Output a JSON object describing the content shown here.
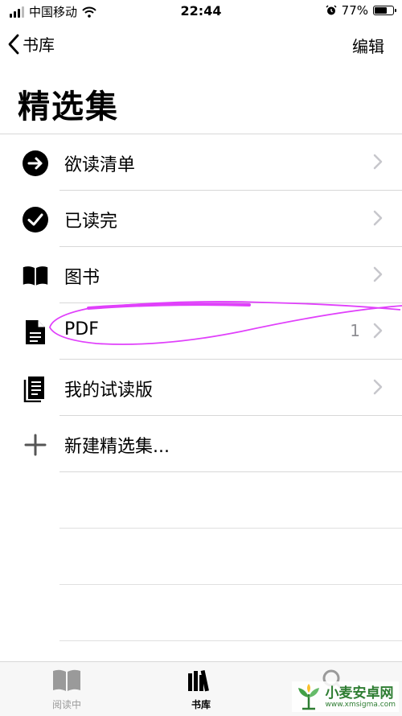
{
  "status_bar": {
    "carrier": "中国移动",
    "time": "22:44",
    "battery_percent": "77%",
    "battery_level": 0.77,
    "icons": [
      "signal-icon",
      "wifi-icon",
      "alarm-icon",
      "battery-icon"
    ]
  },
  "nav": {
    "back_label": "书库",
    "edit_label": "编辑"
  },
  "page": {
    "title": "精选集"
  },
  "collections": [
    {
      "label": "欲读清单",
      "icon": "arrow-right-circle-icon",
      "count": ""
    },
    {
      "label": "已读完",
      "icon": "checkmark-circle-icon",
      "count": ""
    },
    {
      "label": "图书",
      "icon": "book-open-icon",
      "count": ""
    },
    {
      "label": "PDF",
      "icon": "document-icon",
      "count": "1"
    },
    {
      "label": "我的试读版",
      "icon": "sample-pages-icon",
      "count": ""
    },
    {
      "label": "新建精选集...",
      "icon": "plus-icon",
      "count": ""
    }
  ],
  "tab_bar": {
    "tabs": [
      {
        "label": "阅读中",
        "icon": "book-open-icon",
        "active": false
      },
      {
        "label": "书库",
        "icon": "library-icon",
        "active": true
      },
      {
        "label": "",
        "icon": "search-icon",
        "active": false
      }
    ]
  },
  "watermark": {
    "name": "小麦安卓网",
    "url": "www.xmsigma.com"
  },
  "colors": {
    "chevron": "#c7c7cc",
    "annotation": "#e040fb",
    "inactive_tab": "#9a9a9a"
  }
}
